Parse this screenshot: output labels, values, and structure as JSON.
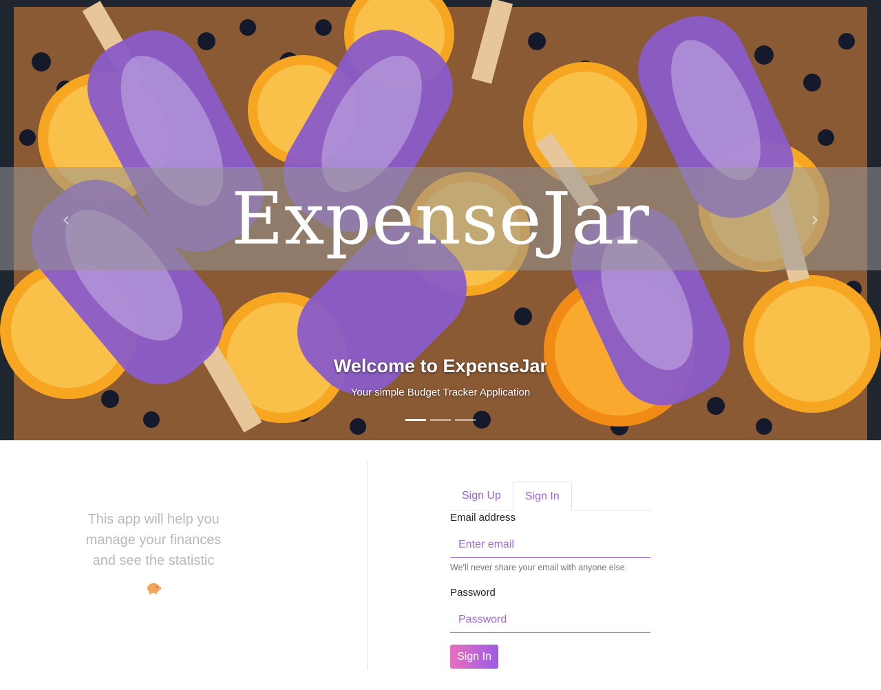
{
  "hero": {
    "title": "ExpenseJar",
    "caption_heading": "Welcome to ExpenseJar",
    "caption_text": "Your simple Budget Tracker Application",
    "prev_icon": "chevron-left-icon",
    "next_icon": "chevron-right-icon",
    "prev_glyph": "‹",
    "next_glyph": "›",
    "slides": 3,
    "active_slide": 1
  },
  "info": {
    "lines": [
      "This app will help you",
      "manage your finances",
      "and see the statistic"
    ],
    "icon": "piggy-bank-icon"
  },
  "tabs": [
    {
      "label": "Sign Up",
      "active": false
    },
    {
      "label": "Sign In",
      "active": true
    }
  ],
  "form": {
    "email_label": "Email address",
    "email_placeholder": "Enter email",
    "email_help": "We'll never share your email with anyone else.",
    "password_label": "Password",
    "password_placeholder": "Password",
    "submit_label": "Sign In"
  },
  "colors": {
    "accent": "#9a62d8",
    "button_gradient_start": "#e86fbe",
    "button_gradient_end": "#9b5de5",
    "piggy": "#f5a55a"
  }
}
